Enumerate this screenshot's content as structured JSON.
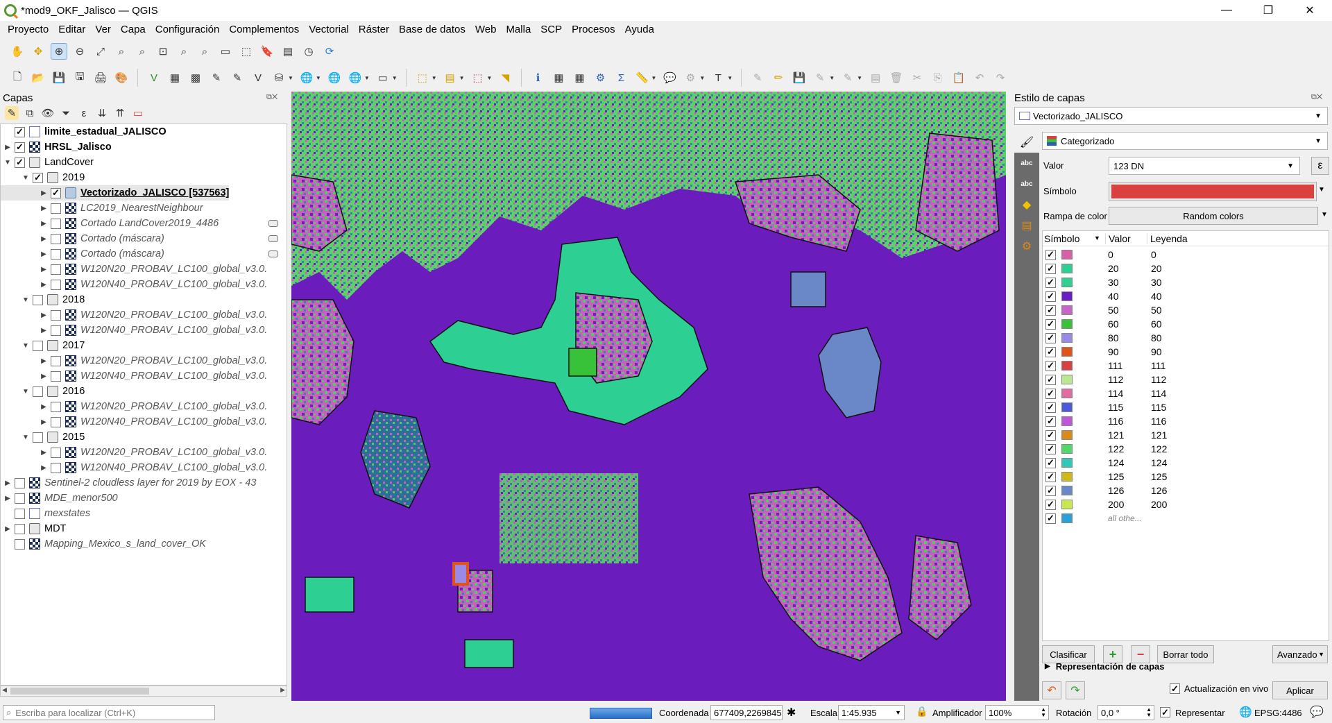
{
  "window": {
    "title": "*mod9_OKF_Jalisco — QGIS",
    "controls": {
      "minimize": "—",
      "restore": "❐",
      "close": "✕"
    }
  },
  "menu": [
    "Proyecto",
    "Editar",
    "Ver",
    "Capa",
    "Configuración",
    "Complementos",
    "Vectorial",
    "Ráster",
    "Base de datos",
    "Web",
    "Malla",
    "SCP",
    "Procesos",
    "Ayuda"
  ],
  "layers_panel": {
    "title": "Capas",
    "items": [
      {
        "label": "limite_estadual_JALISCO",
        "checked": true,
        "expandable": false,
        "indent": 0,
        "icon": "polygon-layer-icon",
        "style": "bold"
      },
      {
        "label": "HRSL_Jalisco",
        "checked": true,
        "expandable": true,
        "indent": 0,
        "icon": "raster-layer-icon",
        "style": "bold"
      },
      {
        "label": "LandCover",
        "checked": true,
        "expandable": true,
        "expanded": true,
        "indent": 0,
        "icon": "group-icon",
        "style": "normal"
      },
      {
        "label": "2019",
        "checked": true,
        "expandable": true,
        "expanded": true,
        "indent": 1,
        "icon": "group-icon",
        "style": "normal"
      },
      {
        "label": "Vectorizado_JALISCO [537563]",
        "checked": true,
        "expandable": true,
        "indent": 2,
        "icon": "vector-layer-icon",
        "style": "bold-underline"
      },
      {
        "label": "LC2019_NearestNeighbour",
        "checked": false,
        "expandable": true,
        "indent": 2,
        "icon": "raster-layer-icon",
        "style": "italic"
      },
      {
        "label": "Cortado LandCover2019_4486",
        "checked": false,
        "expandable": true,
        "indent": 2,
        "icon": "raster-layer-icon",
        "style": "italic",
        "badge": true
      },
      {
        "label": "Cortado (máscara)",
        "checked": false,
        "expandable": true,
        "indent": 2,
        "icon": "raster-layer-icon",
        "style": "italic",
        "badge": true
      },
      {
        "label": "Cortado (máscara)",
        "checked": false,
        "expandable": true,
        "indent": 2,
        "icon": "raster-layer-icon",
        "style": "italic",
        "badge": true
      },
      {
        "label": "W120N20_PROBAV_LC100_global_v3.0.",
        "checked": false,
        "expandable": true,
        "indent": 2,
        "icon": "raster-layer-icon",
        "style": "italic"
      },
      {
        "label": "W120N40_PROBAV_LC100_global_v3.0.",
        "checked": false,
        "expandable": true,
        "indent": 2,
        "icon": "raster-layer-icon",
        "style": "italic"
      },
      {
        "label": "2018",
        "checked": false,
        "expandable": true,
        "expanded": true,
        "indent": 1,
        "icon": "group-icon",
        "style": "normal"
      },
      {
        "label": "W120N20_PROBAV_LC100_global_v3.0.",
        "checked": false,
        "expandable": true,
        "indent": 2,
        "icon": "raster-layer-icon",
        "style": "italic"
      },
      {
        "label": "W120N40_PROBAV_LC100_global_v3.0.",
        "checked": false,
        "expandable": true,
        "indent": 2,
        "icon": "raster-layer-icon",
        "style": "italic"
      },
      {
        "label": "2017",
        "checked": false,
        "expandable": true,
        "expanded": true,
        "indent": 1,
        "icon": "group-icon",
        "style": "normal"
      },
      {
        "label": "W120N20_PROBAV_LC100_global_v3.0.",
        "checked": false,
        "expandable": true,
        "indent": 2,
        "icon": "raster-layer-icon",
        "style": "italic"
      },
      {
        "label": "W120N40_PROBAV_LC100_global_v3.0.",
        "checked": false,
        "expandable": true,
        "indent": 2,
        "icon": "raster-layer-icon",
        "style": "italic"
      },
      {
        "label": "2016",
        "checked": false,
        "expandable": true,
        "expanded": true,
        "indent": 1,
        "icon": "group-icon",
        "style": "normal"
      },
      {
        "label": "W120N20_PROBAV_LC100_global_v3.0.",
        "checked": false,
        "expandable": true,
        "indent": 2,
        "icon": "raster-layer-icon",
        "style": "italic"
      },
      {
        "label": "W120N40_PROBAV_LC100_global_v3.0.",
        "checked": false,
        "expandable": true,
        "indent": 2,
        "icon": "raster-layer-icon",
        "style": "italic"
      },
      {
        "label": "2015",
        "checked": false,
        "expandable": true,
        "expanded": true,
        "indent": 1,
        "icon": "group-icon",
        "style": "normal"
      },
      {
        "label": "W120N20_PROBAV_LC100_global_v3.0.",
        "checked": false,
        "expandable": true,
        "indent": 2,
        "icon": "raster-layer-icon",
        "style": "italic"
      },
      {
        "label": "W120N40_PROBAV_LC100_global_v3.0.",
        "checked": false,
        "expandable": true,
        "indent": 2,
        "icon": "raster-layer-icon",
        "style": "italic"
      },
      {
        "label": "Sentinel-2 cloudless layer for 2019 by EOX - 43",
        "checked": false,
        "expandable": true,
        "indent": 0,
        "icon": "raster-layer-icon",
        "style": "italic"
      },
      {
        "label": "MDE_menor500",
        "checked": false,
        "expandable": true,
        "indent": 0,
        "icon": "raster-layer-icon",
        "style": "italic"
      },
      {
        "label": "mexstates",
        "checked": false,
        "expandable": false,
        "indent": 0,
        "icon": "polygon-layer-icon",
        "style": "italic"
      },
      {
        "label": "MDT",
        "checked": false,
        "expandable": true,
        "indent": 0,
        "icon": "group-icon",
        "style": "normal"
      },
      {
        "label": "Mapping_Mexico_s_land_cover_OK",
        "checked": false,
        "expandable": false,
        "indent": 0,
        "icon": "raster-layer-icon",
        "style": "italic"
      }
    ]
  },
  "style_panel": {
    "title": "Estilo de capas",
    "layer": "Vectorizado_JALISCO",
    "renderer": "Categorizado",
    "value_label": "Valor",
    "value": "123 DN",
    "expression_icon": "ε",
    "symbol_label": "Símbolo",
    "symbol_color": "#d94040",
    "ramp_label": "Rampa de color",
    "ramp_value": "Random colors",
    "headers": {
      "symbol": "Símbolo",
      "value": "Valor",
      "legend": "Leyenda"
    },
    "categories": [
      {
        "value": "0",
        "legend": "0",
        "color": "#d95fa8"
      },
      {
        "value": "20",
        "legend": "20",
        "color": "#2ecf93"
      },
      {
        "value": "30",
        "legend": "30",
        "color": "#30d090"
      },
      {
        "value": "40",
        "legend": "40",
        "color": "#6a1fc4"
      },
      {
        "value": "50",
        "legend": "50",
        "color": "#c964c8"
      },
      {
        "value": "60",
        "legend": "60",
        "color": "#38c23a"
      },
      {
        "value": "80",
        "legend": "80",
        "color": "#9a8ae8"
      },
      {
        "value": "90",
        "legend": "90",
        "color": "#e0541a"
      },
      {
        "value": "111",
        "legend": "111",
        "color": "#d94040"
      },
      {
        "value": "112",
        "legend": "112",
        "color": "#b8e890"
      },
      {
        "value": "114",
        "legend": "114",
        "color": "#e06ca0"
      },
      {
        "value": "115",
        "legend": "115",
        "color": "#4a5ad8"
      },
      {
        "value": "116",
        "legend": "116",
        "color": "#c056d8"
      },
      {
        "value": "121",
        "legend": "121",
        "color": "#d88a1a"
      },
      {
        "value": "122",
        "legend": "122",
        "color": "#50d86a"
      },
      {
        "value": "124",
        "legend": "124",
        "color": "#30c8b8"
      },
      {
        "value": "125",
        "legend": "125",
        "color": "#d0b818"
      },
      {
        "value": "126",
        "legend": "126",
        "color": "#6a88c8"
      },
      {
        "value": "200",
        "legend": "200",
        "color": "#c8e850"
      },
      {
        "value": "all othe...",
        "legend": "",
        "color": "#2aa0d8"
      }
    ],
    "buttons": {
      "classify": "Clasificar",
      "add": "+",
      "remove": "−",
      "delete_all": "Borrar todo",
      "advanced": "Avanzado"
    },
    "layer_rendering": "Representación de capas",
    "live_update": "Actualización en vivo",
    "apply": "Aplicar"
  },
  "statusbar": {
    "search_placeholder": "Escriba para localizar (Ctrl+K)",
    "coord_label": "Coordenada",
    "coord_value": "677409,2269845",
    "scale_label": "Escala",
    "scale_value": "1:45.935",
    "magnifier_label": "Amplificador",
    "magnifier_value": "100%",
    "rotation_label": "Rotación",
    "rotation_value": "0,0 °",
    "render_label": "Representar",
    "crs": "EPSG:4486"
  }
}
